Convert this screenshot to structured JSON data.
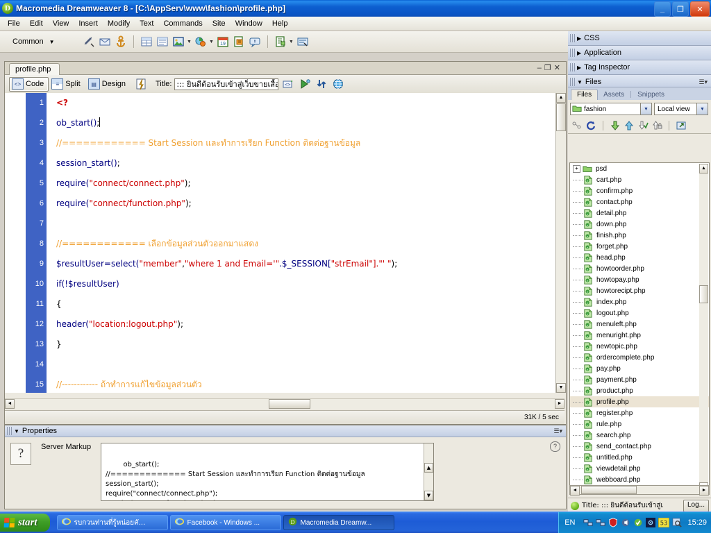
{
  "window": {
    "title": "Macromedia Dreamweaver 8 - [C:\\AppServ\\www\\fashion\\profile.php]",
    "minimize": "_",
    "restore": "❐",
    "close": "✕"
  },
  "menubar": [
    "File",
    "Edit",
    "View",
    "Insert",
    "Modify",
    "Text",
    "Commands",
    "Site",
    "Window",
    "Help"
  ],
  "insertbar": {
    "category": "Common",
    "arrow": "▼",
    "icons": [
      "hyperlink-broken-icon",
      "email-link-icon",
      "anchor-icon",
      "table-icon",
      "table-row-icon",
      "image-icon",
      "media-icon",
      "date-icon",
      "template-icon",
      "comment-icon",
      "tag-chooser-icon",
      "server-behavior-icon"
    ]
  },
  "coding_toolbar": [
    "open-documents-icon",
    "collapse-full-tag-icon",
    "collapse-outside-selection-icon",
    "expand-all-icon",
    "select-parent-tag-icon",
    "balance-braces-icon",
    "line-numbers-icon",
    "highlight-invalid-code-icon",
    "apply-comment-icon",
    "remove-comment-icon",
    "wrap-tag-icon",
    "recent-snippets-icon",
    "indent-code-icon",
    "outdent-code-icon",
    "format-source-code-icon"
  ],
  "document": {
    "tab": "profile.php",
    "win_minimize": "–",
    "win_restore": "❐",
    "win_close": "✕",
    "views": [
      {
        "label": "Code",
        "active": true,
        "icon": "code-view-icon"
      },
      {
        "label": "Split",
        "active": false,
        "icon": "split-view-icon"
      },
      {
        "label": "Design",
        "active": false,
        "icon": "design-view-icon"
      }
    ],
    "live_data_icon": "live-data-icon",
    "title_label": "Title:",
    "title_value": "::: ยินดีต้อนรับเข้าสู่เว็บขายเสื้อผ",
    "toolbar_right_icons": [
      "file-management-icon",
      "preview-debug-icon",
      "refresh-design-icon",
      "view-options-icon"
    ],
    "status": "31K / 5 sec"
  },
  "code": {
    "lines": [
      {
        "n": "1",
        "parts": [
          {
            "t": "<?",
            "c": "tag"
          }
        ]
      },
      {
        "n": "2",
        "parts": [
          {
            "t": "ob_start()",
            "c": "fn"
          },
          {
            "t": ";",
            "c": "plain"
          }
        ],
        "caret": true
      },
      {
        "n": "3",
        "parts": [
          {
            "t": "//============ Start Session และทำการเรียก Function ติดต่อฐานข้อมูล",
            "c": "cmt"
          }
        ]
      },
      {
        "n": "4",
        "parts": [
          {
            "t": "session_start()",
            "c": "fn"
          },
          {
            "t": ";",
            "c": "plain"
          }
        ]
      },
      {
        "n": "5",
        "parts": [
          {
            "t": "require(",
            "c": "fn"
          },
          {
            "t": "\"connect/connect.php\"",
            "c": "str"
          },
          {
            "t": ");",
            "c": "plain"
          }
        ]
      },
      {
        "n": "6",
        "parts": [
          {
            "t": "require(",
            "c": "fn"
          },
          {
            "t": "\"connect/function.php\"",
            "c": "str"
          },
          {
            "t": ");",
            "c": "plain"
          }
        ]
      },
      {
        "n": "7",
        "parts": []
      },
      {
        "n": "8",
        "parts": [
          {
            "t": "//============ เลือกข้อมูลส่วนตัวออกมาแสดง",
            "c": "cmt"
          }
        ]
      },
      {
        "n": "9",
        "parts": [
          {
            "t": "$resultUser=select(",
            "c": "var"
          },
          {
            "t": "\"member\"",
            "c": "str"
          },
          {
            "t": ",",
            "c": "plain"
          },
          {
            "t": "\"where 1 and Email='\"",
            "c": "str"
          },
          {
            "t": ".$_SESSION[",
            "c": "var"
          },
          {
            "t": "\"strEmail\"",
            "c": "str"
          },
          {
            "t": "].\"' \"",
            "c": "str"
          },
          {
            "t": ");",
            "c": "plain"
          }
        ]
      },
      {
        "n": "10",
        "parts": [
          {
            "t": "if(!$resultUser)",
            "c": "var"
          }
        ]
      },
      {
        "n": "11",
        "parts": [
          {
            "t": "{",
            "c": "plain"
          }
        ]
      },
      {
        "n": "12",
        "parts": [
          {
            "t": "header(",
            "c": "fn"
          },
          {
            "t": "\"location:logout.php\"",
            "c": "str"
          },
          {
            "t": ");",
            "c": "plain"
          }
        ]
      },
      {
        "n": "13",
        "parts": [
          {
            "t": "}",
            "c": "plain"
          }
        ]
      },
      {
        "n": "14",
        "parts": []
      },
      {
        "n": "15",
        "parts": [
          {
            "t": "//------------ ถ้าทำการแก้ไขข้อมูลส่วนตัว",
            "c": "cmt"
          }
        ]
      }
    ]
  },
  "panels": {
    "groups": [
      {
        "label": "CSS",
        "expanded": false,
        "arrow": "▶"
      },
      {
        "label": "Application",
        "expanded": false,
        "arrow": "▶"
      },
      {
        "label": "Tag Inspector",
        "expanded": false,
        "arrow": "▶"
      },
      {
        "label": "Files",
        "expanded": true,
        "arrow": "▼"
      }
    ],
    "files": {
      "tabs": [
        {
          "label": "Files",
          "active": true
        },
        {
          "label": "Assets",
          "active": false
        },
        {
          "label": "Snippets",
          "active": false
        }
      ],
      "site_combo": "fashion",
      "view_combo": "Local view",
      "toolbar_icons": [
        "connect-remote-icon",
        "refresh-icon",
        "get-files-icon",
        "put-files-icon",
        "check-out-icon",
        "check-in-icon",
        "expand-collapse-icon"
      ],
      "items": [
        {
          "name": "psd",
          "type": "folder",
          "expandable": true,
          "selected": false
        },
        {
          "name": "cart.php",
          "type": "php",
          "selected": false
        },
        {
          "name": "confirm.php",
          "type": "php",
          "selected": false
        },
        {
          "name": "contact.php",
          "type": "php",
          "selected": false
        },
        {
          "name": "detail.php",
          "type": "php",
          "selected": false
        },
        {
          "name": "down.php",
          "type": "php",
          "selected": false
        },
        {
          "name": "finish.php",
          "type": "php",
          "selected": false
        },
        {
          "name": "forget.php",
          "type": "php",
          "selected": false
        },
        {
          "name": "head.php",
          "type": "php",
          "selected": false
        },
        {
          "name": "howtoorder.php",
          "type": "php",
          "selected": false
        },
        {
          "name": "howtopay.php",
          "type": "php",
          "selected": false
        },
        {
          "name": "howtorecipt.php",
          "type": "php",
          "selected": false
        },
        {
          "name": "index.php",
          "type": "php",
          "selected": false
        },
        {
          "name": "logout.php",
          "type": "php",
          "selected": false
        },
        {
          "name": "menuleft.php",
          "type": "php",
          "selected": false
        },
        {
          "name": "menuright.php",
          "type": "php",
          "selected": false
        },
        {
          "name": "newtopic.php",
          "type": "php",
          "selected": false
        },
        {
          "name": "ordercomplete.php",
          "type": "php",
          "selected": false
        },
        {
          "name": "pay.php",
          "type": "php",
          "selected": false
        },
        {
          "name": "payment.php",
          "type": "php",
          "selected": false
        },
        {
          "name": "product.php",
          "type": "php",
          "selected": false
        },
        {
          "name": "profile.php",
          "type": "php",
          "selected": true
        },
        {
          "name": "register.php",
          "type": "php",
          "selected": false
        },
        {
          "name": "rule.php",
          "type": "php",
          "selected": false
        },
        {
          "name": "search.php",
          "type": "php",
          "selected": false
        },
        {
          "name": "send_contact.php",
          "type": "php",
          "selected": false
        },
        {
          "name": "untitled.php",
          "type": "php",
          "selected": false
        },
        {
          "name": "viewdetail.php",
          "type": "php",
          "selected": false
        },
        {
          "name": "webboard.php",
          "type": "php",
          "selected": false
        }
      ],
      "status_title": "Title: ::: ยินดีต้อนรับเข้าสู่เ",
      "log_button": "Log..."
    }
  },
  "properties": {
    "header": "Properties",
    "arrow": "▼",
    "icon_glyph": "?",
    "label": "Server Markup",
    "markup_text": "ob_start();\n//============= Start Session และทำการเรียก Function ติดต่อฐานข้อมูล\nsession_start();\nrequire(\"connect/connect.php\");\nrequire(\"connect/function.php\");",
    "help": "?"
  },
  "taskbar": {
    "start": "start",
    "items": [
      {
        "label": "รบกวนท่านที่รู้หน่อยคั...",
        "icon": "ie-icon",
        "active": false
      },
      {
        "label": "Facebook - Windows ...",
        "icon": "ie-icon",
        "active": false
      },
      {
        "label": "Macromedia Dreamw...",
        "icon": "dreamweaver-icon",
        "active": true
      }
    ],
    "language": "EN",
    "clock": "15:29",
    "tray_icons": [
      "network-icon",
      "network2-icon",
      "security-shield-icon",
      "volume-icon",
      "updates-icon",
      "wireless-icon",
      "display-icon",
      "search-icon"
    ]
  }
}
